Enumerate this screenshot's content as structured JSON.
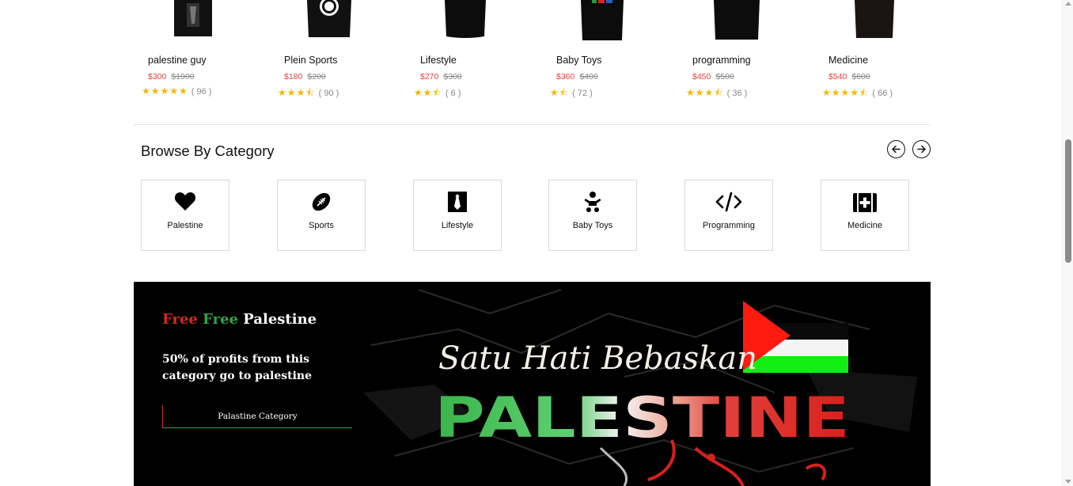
{
  "products": [
    {
      "name": "palestine guy",
      "price": "$300",
      "old_price": "$1000",
      "stars": "★★★★★",
      "count": "( 96 )"
    },
    {
      "name": "Plein Sports",
      "price": "$180",
      "old_price": "$200",
      "stars": "★★★⯪",
      "count": "( 90 )"
    },
    {
      "name": "Lifestyle",
      "price": "$270",
      "old_price": "$300",
      "stars": "★★⯪",
      "count": "( 6 )"
    },
    {
      "name": "Baby Toys",
      "price": "$360",
      "old_price": "$400",
      "stars": "★⯪",
      "count": "( 72 )"
    },
    {
      "name": "programming",
      "price": "$450",
      "old_price": "$500",
      "stars": "★★★⯪",
      "count": "( 36 )"
    },
    {
      "name": "Medicine",
      "price": "$540",
      "old_price": "$600",
      "stars": "★★★★⯪",
      "count": "( 66 )"
    }
  ],
  "category": {
    "title": "Browse By Category",
    "items": [
      {
        "label": "Palestine",
        "icon": "heart-icon"
      },
      {
        "label": "Sports",
        "icon": "football-icon"
      },
      {
        "label": "Lifestyle",
        "icon": "tie-icon"
      },
      {
        "label": "Baby Toys",
        "icon": "baby-icon"
      },
      {
        "label": "Programming",
        "icon": "code-icon"
      },
      {
        "label": "Medicine",
        "icon": "medkit-icon"
      }
    ]
  },
  "banner": {
    "headline_red": "Free",
    "headline_green": "Free",
    "headline_white": "Palestine",
    "subtitle": "50% of profits from this category go to palestine",
    "cta": "Palastine Category",
    "art_script": "Satu Hati Bebaskan",
    "art_word": "PALESTINE"
  },
  "colors": {
    "price": "#e0453d",
    "star": "#f5b700",
    "flag_red": "#ff0000",
    "flag_green": "#00ff00"
  }
}
